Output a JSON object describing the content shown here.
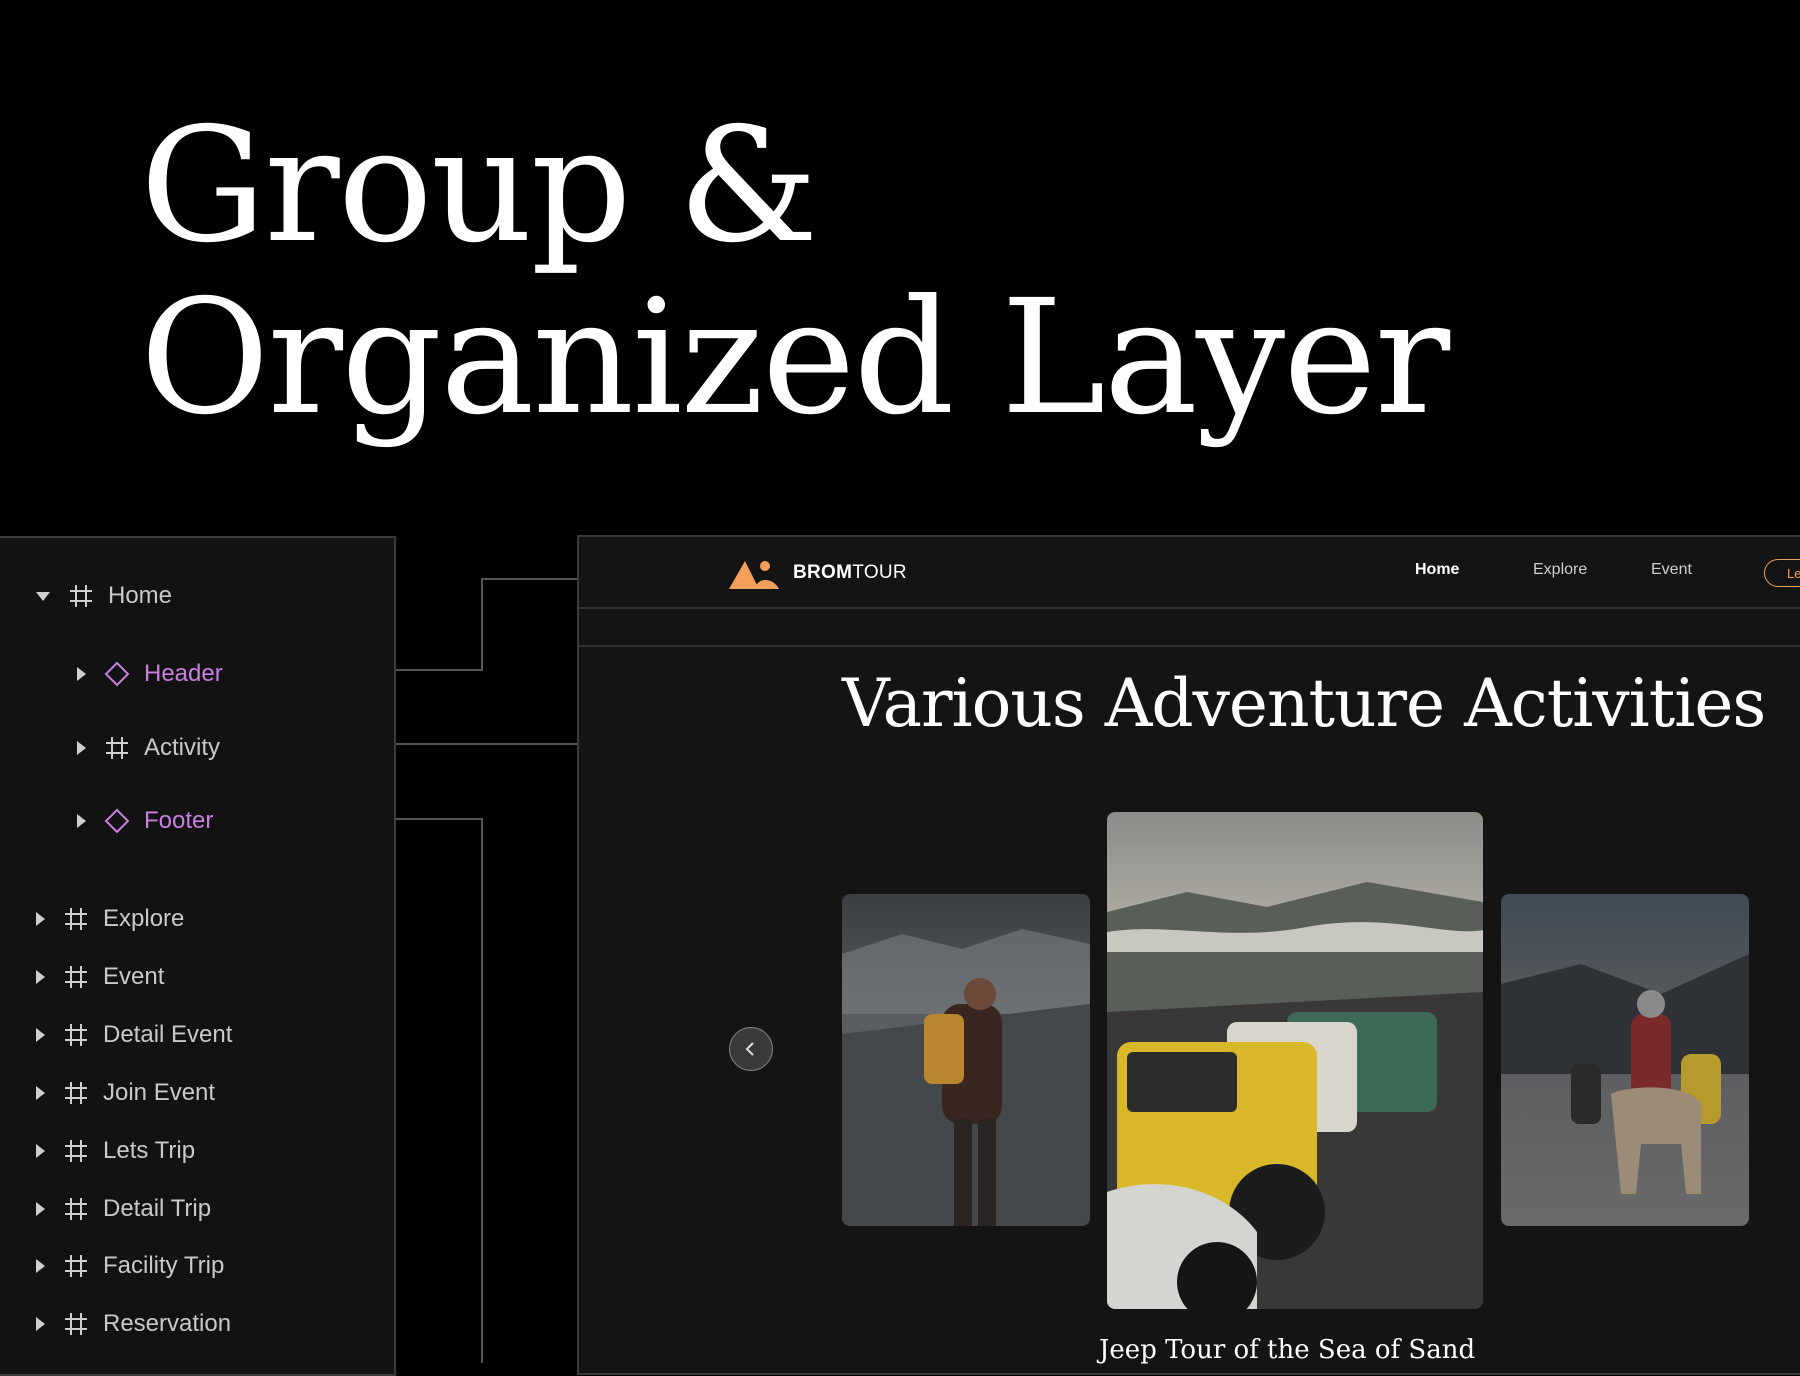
{
  "hero": {
    "line1": "Group &",
    "line2": "Organized Layer"
  },
  "layers": {
    "root": "Home",
    "children": [
      "Header",
      "Activity",
      "Footer"
    ],
    "pages": [
      "Explore",
      "Event",
      "Detail Event",
      "Join Event",
      "Lets Trip",
      "Detail Trip",
      "Facility Trip",
      "Reservation"
    ]
  },
  "site": {
    "brand_bold": "BROM",
    "brand_rest": "TOUR",
    "nav": [
      "Home",
      "Explore",
      "Event"
    ],
    "cta": "Le",
    "section_title": "Various Adventure Activities",
    "card_caption": "Jeep Tour of the Sea of Sand",
    "accent": "#f2a05a"
  },
  "colors": {
    "component": "#c97fe0",
    "frame": "#cfcfcf"
  }
}
